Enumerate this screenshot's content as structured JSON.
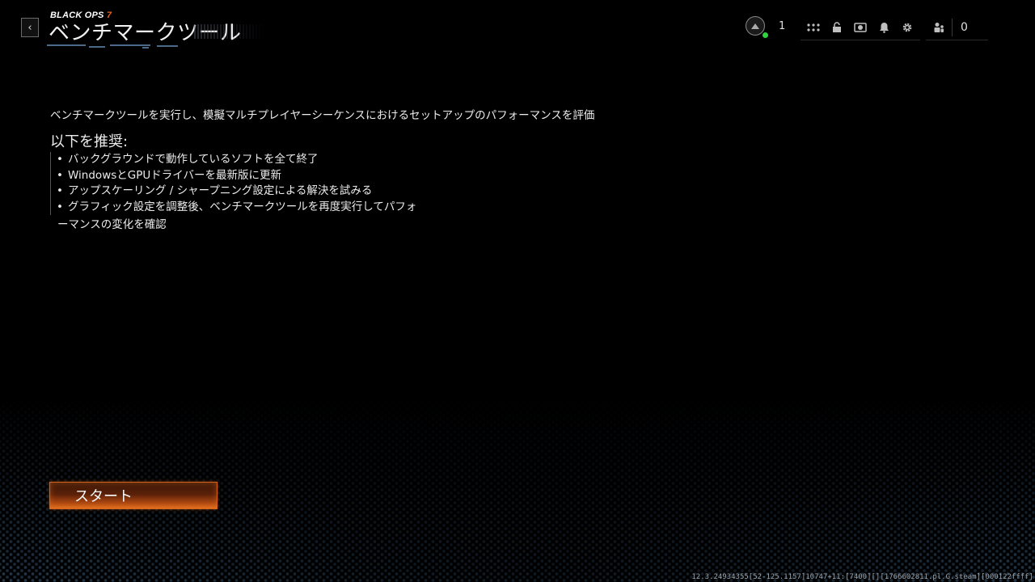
{
  "header": {
    "game_logo_main": "BLACK OPS",
    "game_logo_number": "7",
    "title": "ベンチマークツール",
    "back_label": "‹"
  },
  "status": {
    "player_count": "1",
    "friends_count": "0",
    "online_color": "#30d040",
    "icons": [
      "grid-icon",
      "unlock-icon",
      "camera-icon",
      "bell-icon",
      "gear-icon"
    ],
    "friends_icon": "friends-icon",
    "rank_icon": "rank-emblem-icon"
  },
  "main": {
    "description": "ベンチマークツールを実行し、模擬マルチプレイヤーシーケンスにおけるセットアップのパフォーマンスを評価",
    "recommend_heading": "以下を推奨:",
    "recommendations": [
      "バックグラウンドで動作しているソフトを全て終了",
      "WindowsとGPUドライバーを最新版に更新",
      "アップスケーリング / シャープニング設定による解決を試みる",
      "グラフィック設定を調整後、ベンチマークツールを再度実行してパフォ"
    ],
    "recommend_tail": "ーマンスの変化を確認",
    "start_button": "スタート"
  },
  "footer": {
    "version": "12.3.24934355[52-125.1157]10747+11:[7400][][1766602811.pl.G.steam][000122ffff]"
  },
  "colors": {
    "accent": "#d5621c",
    "background": "#000000",
    "text": "#ececec"
  }
}
